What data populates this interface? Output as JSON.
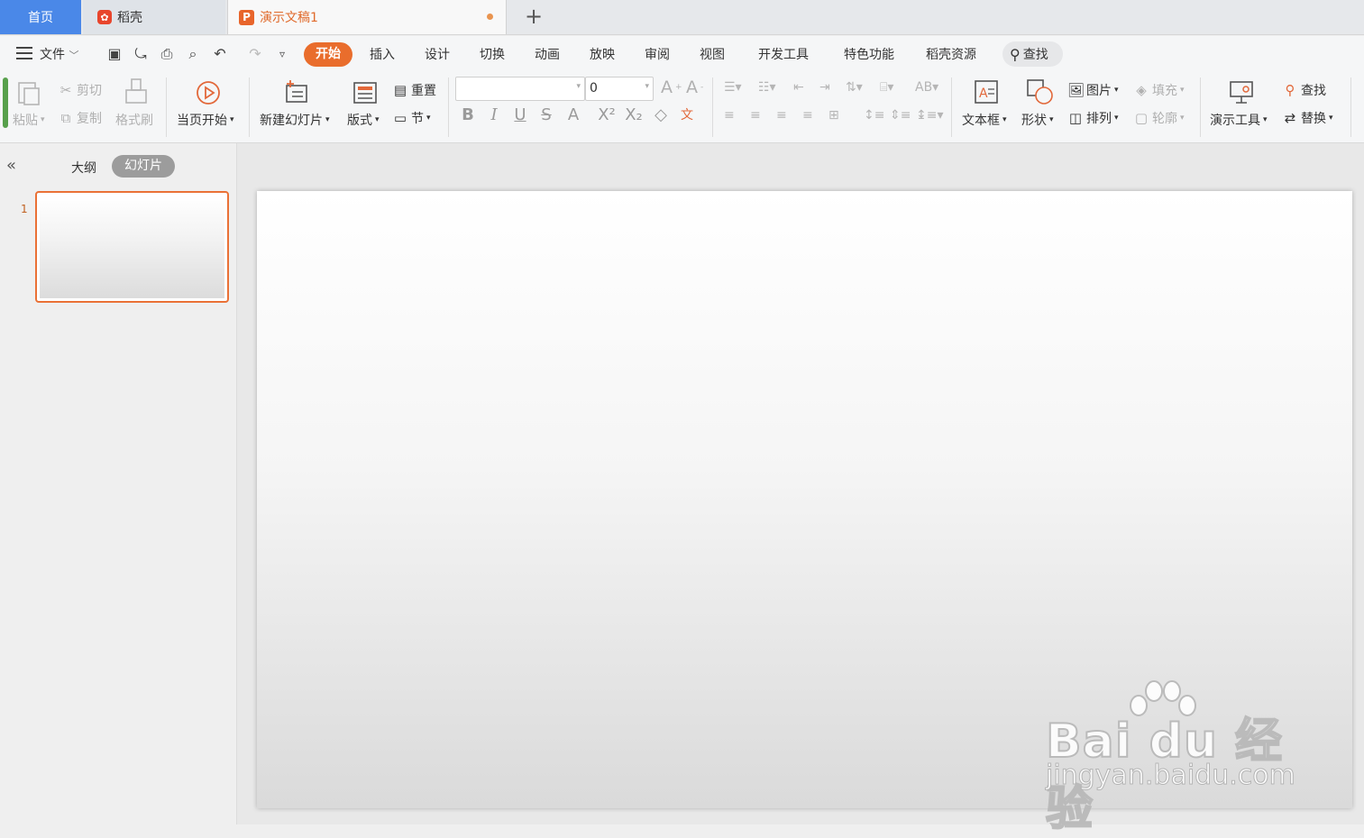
{
  "tabs": {
    "home": "首页",
    "daoke": "稻壳",
    "document": "演示文稿1"
  },
  "menu": {
    "file": "文件",
    "items": [
      "开始",
      "插入",
      "设计",
      "切换",
      "动画",
      "放映",
      "审阅",
      "视图",
      "开发工具",
      "特色功能",
      "稻壳资源"
    ],
    "search": "查找"
  },
  "ribbon": {
    "paste": "粘贴",
    "cut": "剪切",
    "copy": "复制",
    "format_painter": "格式刷",
    "from_current": "当页开始",
    "new_slide": "新建幻灯片",
    "layout": "版式",
    "reset": "重置",
    "section": "节",
    "font_size": "0",
    "text_box": "文本框",
    "shape": "形状",
    "picture": "图片",
    "fill": "填充",
    "arrange": "排列",
    "outline": "轮廓",
    "presentation_tools": "演示工具",
    "find": "查找",
    "replace": "替换"
  },
  "panel": {
    "outline_tab": "大纲",
    "slides_tab": "幻灯片",
    "slide_number": "1"
  },
  "watermark": {
    "brand": "Bai du 经验",
    "url": "jingyan.baidu.com"
  },
  "colors": {
    "accent": "#e96d2c",
    "home_tab": "#4a88e8"
  }
}
